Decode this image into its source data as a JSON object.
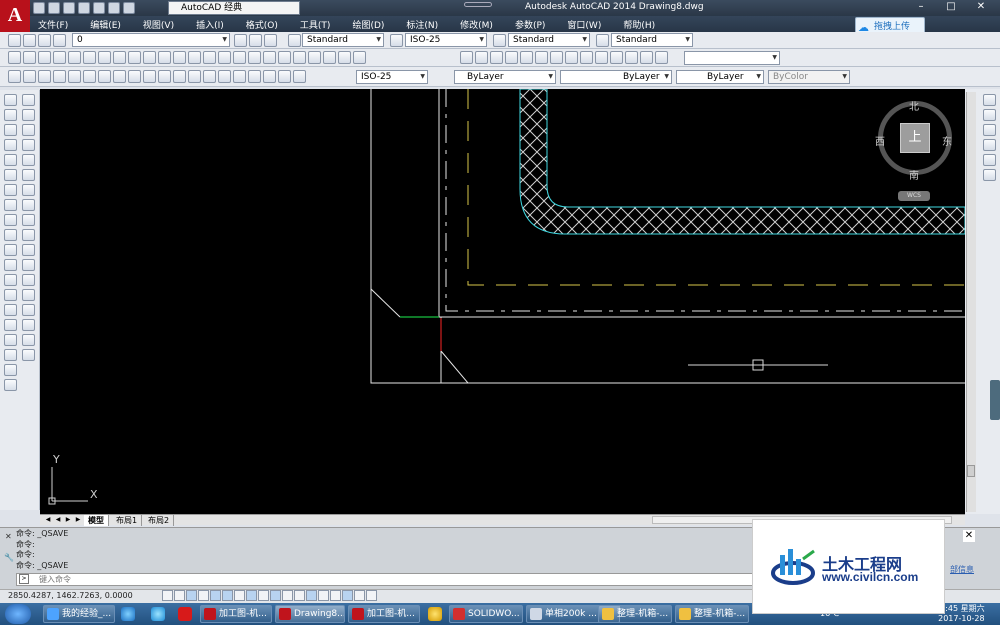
{
  "app": {
    "logo_letter": "A",
    "window_title": "Autodesk AutoCAD 2014    Drawing8.dwg",
    "workspace": "AutoCAD 经典",
    "upload_label": "拖拽上传"
  },
  "window_controls": {
    "minimize": "–",
    "maximize": "□",
    "close": "✕"
  },
  "menubar": {
    "items": [
      "文件(F)",
      "编辑(E)",
      "视图(V)",
      "插入(I)",
      "格式(O)",
      "工具(T)",
      "绘图(D)",
      "标注(N)",
      "修改(M)",
      "参数(P)",
      "窗口(W)",
      "帮助(H)"
    ]
  },
  "toolbars": {
    "layer_current": "0",
    "text_style": "Standard",
    "dim_style": "ISO-25",
    "table_style": "Standard",
    "mleader_style": "Standard",
    "dim_style_2": "ISO-25",
    "color": "ByLayer",
    "linetype": "ByLayer",
    "lineweight": "ByLayer",
    "plot_style": "ByColor"
  },
  "viewcube": {
    "north": "北",
    "south": "南",
    "east": "东",
    "west": "西",
    "face": "上",
    "wcs": "WCS"
  },
  "ucs": {
    "y_label": "Y",
    "x_label": "X"
  },
  "layout_tabs": {
    "model": "模型",
    "layout1": "布局1",
    "layout2": "布局2"
  },
  "command": {
    "history": [
      "命令: _QSAVE",
      "命令:",
      "命令:",
      "命令: _QSAVE"
    ],
    "input_placeholder": "键入命令"
  },
  "status": {
    "coords": "2850.4287,  1462.7263,  0.0000"
  },
  "taskbar": {
    "items": [
      {
        "label": "我的经验_..."
      },
      {
        "label": "加工图-机..."
      },
      {
        "label": "Drawing8...."
      },
      {
        "label": "加工图-机..."
      },
      {
        "label": "SOLIDWO..."
      },
      {
        "label": "单相200k ..."
      },
      {
        "label": "整理-机箱-..."
      },
      {
        "label": "整理-机箱-..."
      }
    ],
    "temperature": "16℃",
    "time": "17:45 星期六",
    "date": "2017-10-28"
  },
  "ad": {
    "title": "土木工程网",
    "url": "www.civilcn.com",
    "side_text": "部信息"
  },
  "colors": {
    "canvas": "#000000",
    "cyan_lines": "#3fd7e0",
    "yellow_dash": "#d8c64a",
    "green_line": "#18c040",
    "red_line": "#d02020",
    "brand_red": "#b8111b"
  }
}
